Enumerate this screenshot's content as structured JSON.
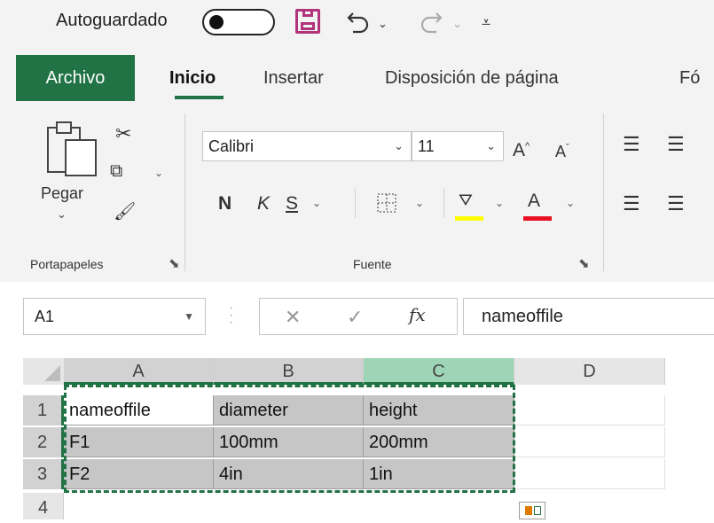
{
  "qat": {
    "autosave_label": "Autoguardado",
    "save_icon": "save-icon",
    "undo_icon": "undo-icon",
    "redo_icon": "redo-icon",
    "customize_icon": "customize-qat-icon"
  },
  "tabs": {
    "file": "Archivo",
    "home": "Inicio",
    "insert": "Insertar",
    "layout": "Disposición de página",
    "formulas": "Fó"
  },
  "ribbon": {
    "clipboard": {
      "paste_label": "Pegar",
      "group_label": "Portapapeles"
    },
    "font": {
      "font_name": "Calibri",
      "font_size": "11",
      "bold": "N",
      "italic": "K",
      "underline": "S",
      "font_color_letter": "A",
      "highlight_color": "#ffff00",
      "font_color": "#e81123",
      "group_label": "Fuente"
    }
  },
  "formula_bar": {
    "name_box": "A1",
    "cancel_symbol": "✕",
    "enter_symbol": "✓",
    "fx_symbol": "fx",
    "content": "nameoffile"
  },
  "sheet": {
    "columns": [
      "A",
      "B",
      "C",
      "D"
    ],
    "rows": [
      "1",
      "2",
      "3",
      "4"
    ],
    "cells": [
      [
        "nameoffile",
        "diameter",
        "height"
      ],
      [
        "F1",
        "100mm",
        "200mm"
      ],
      [
        "F2",
        "4in",
        "1in"
      ]
    ]
  },
  "colors": {
    "accent": "#217346",
    "selection_fill": "#c6c6c6"
  }
}
